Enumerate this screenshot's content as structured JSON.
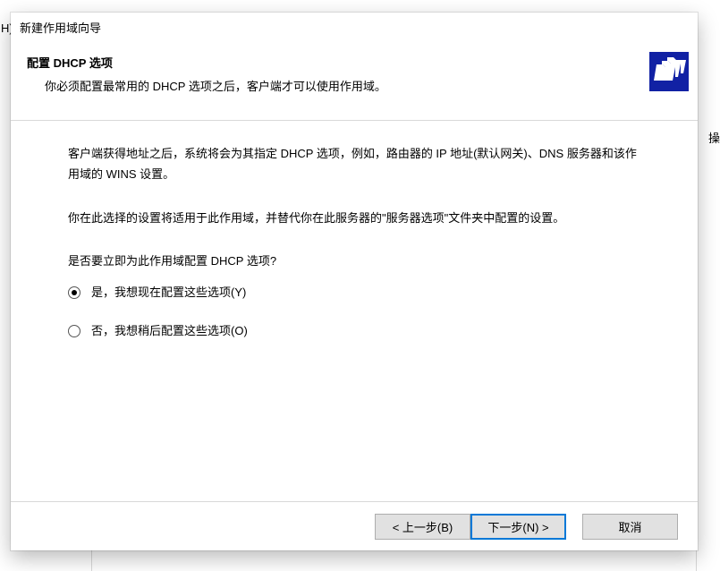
{
  "background": {
    "left_char": "H)",
    "right_char": "操"
  },
  "wizard": {
    "title": "新建作用域向导",
    "header_title": "配置 DHCP 选项",
    "header_sub": "你必须配置最常用的 DHCP 选项之后，客户端才可以使用作用域。",
    "para1": "客户端获得地址之后，系统将会为其指定 DHCP 选项，例如，路由器的 IP 地址(默认网关)、DNS 服务器和该作用域的 WINS 设置。",
    "para2": "你在此选择的设置将适用于此作用域，并替代你在此服务器的\"服务器选项\"文件夹中配置的设置。",
    "question": "是否要立即为此作用域配置 DHCP 选项?",
    "radio_yes": "是，我想现在配置这些选项(Y)",
    "radio_no": "否，我想稍后配置这些选项(O)",
    "btn_back": "< 上一步(B)",
    "btn_next": "下一步(N) >",
    "btn_cancel": "取消"
  }
}
